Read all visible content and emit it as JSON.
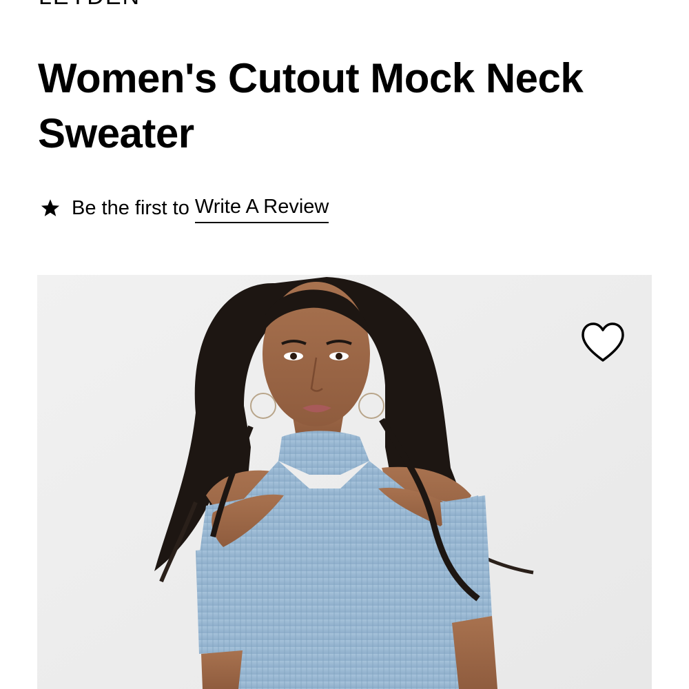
{
  "product": {
    "brand": "LEYDEN",
    "title": "Women's Cutout Mock Neck Sweater"
  },
  "reviews": {
    "prefix": "Be the first to",
    "link_label": "Write A Review",
    "icon": "star-icon"
  },
  "image": {
    "wishlist_icon": "heart-outline-icon"
  },
  "colors": {
    "text": "#000000",
    "background": "#ffffff",
    "image_background": "#efefef",
    "sweater": "#9ab8d2"
  }
}
